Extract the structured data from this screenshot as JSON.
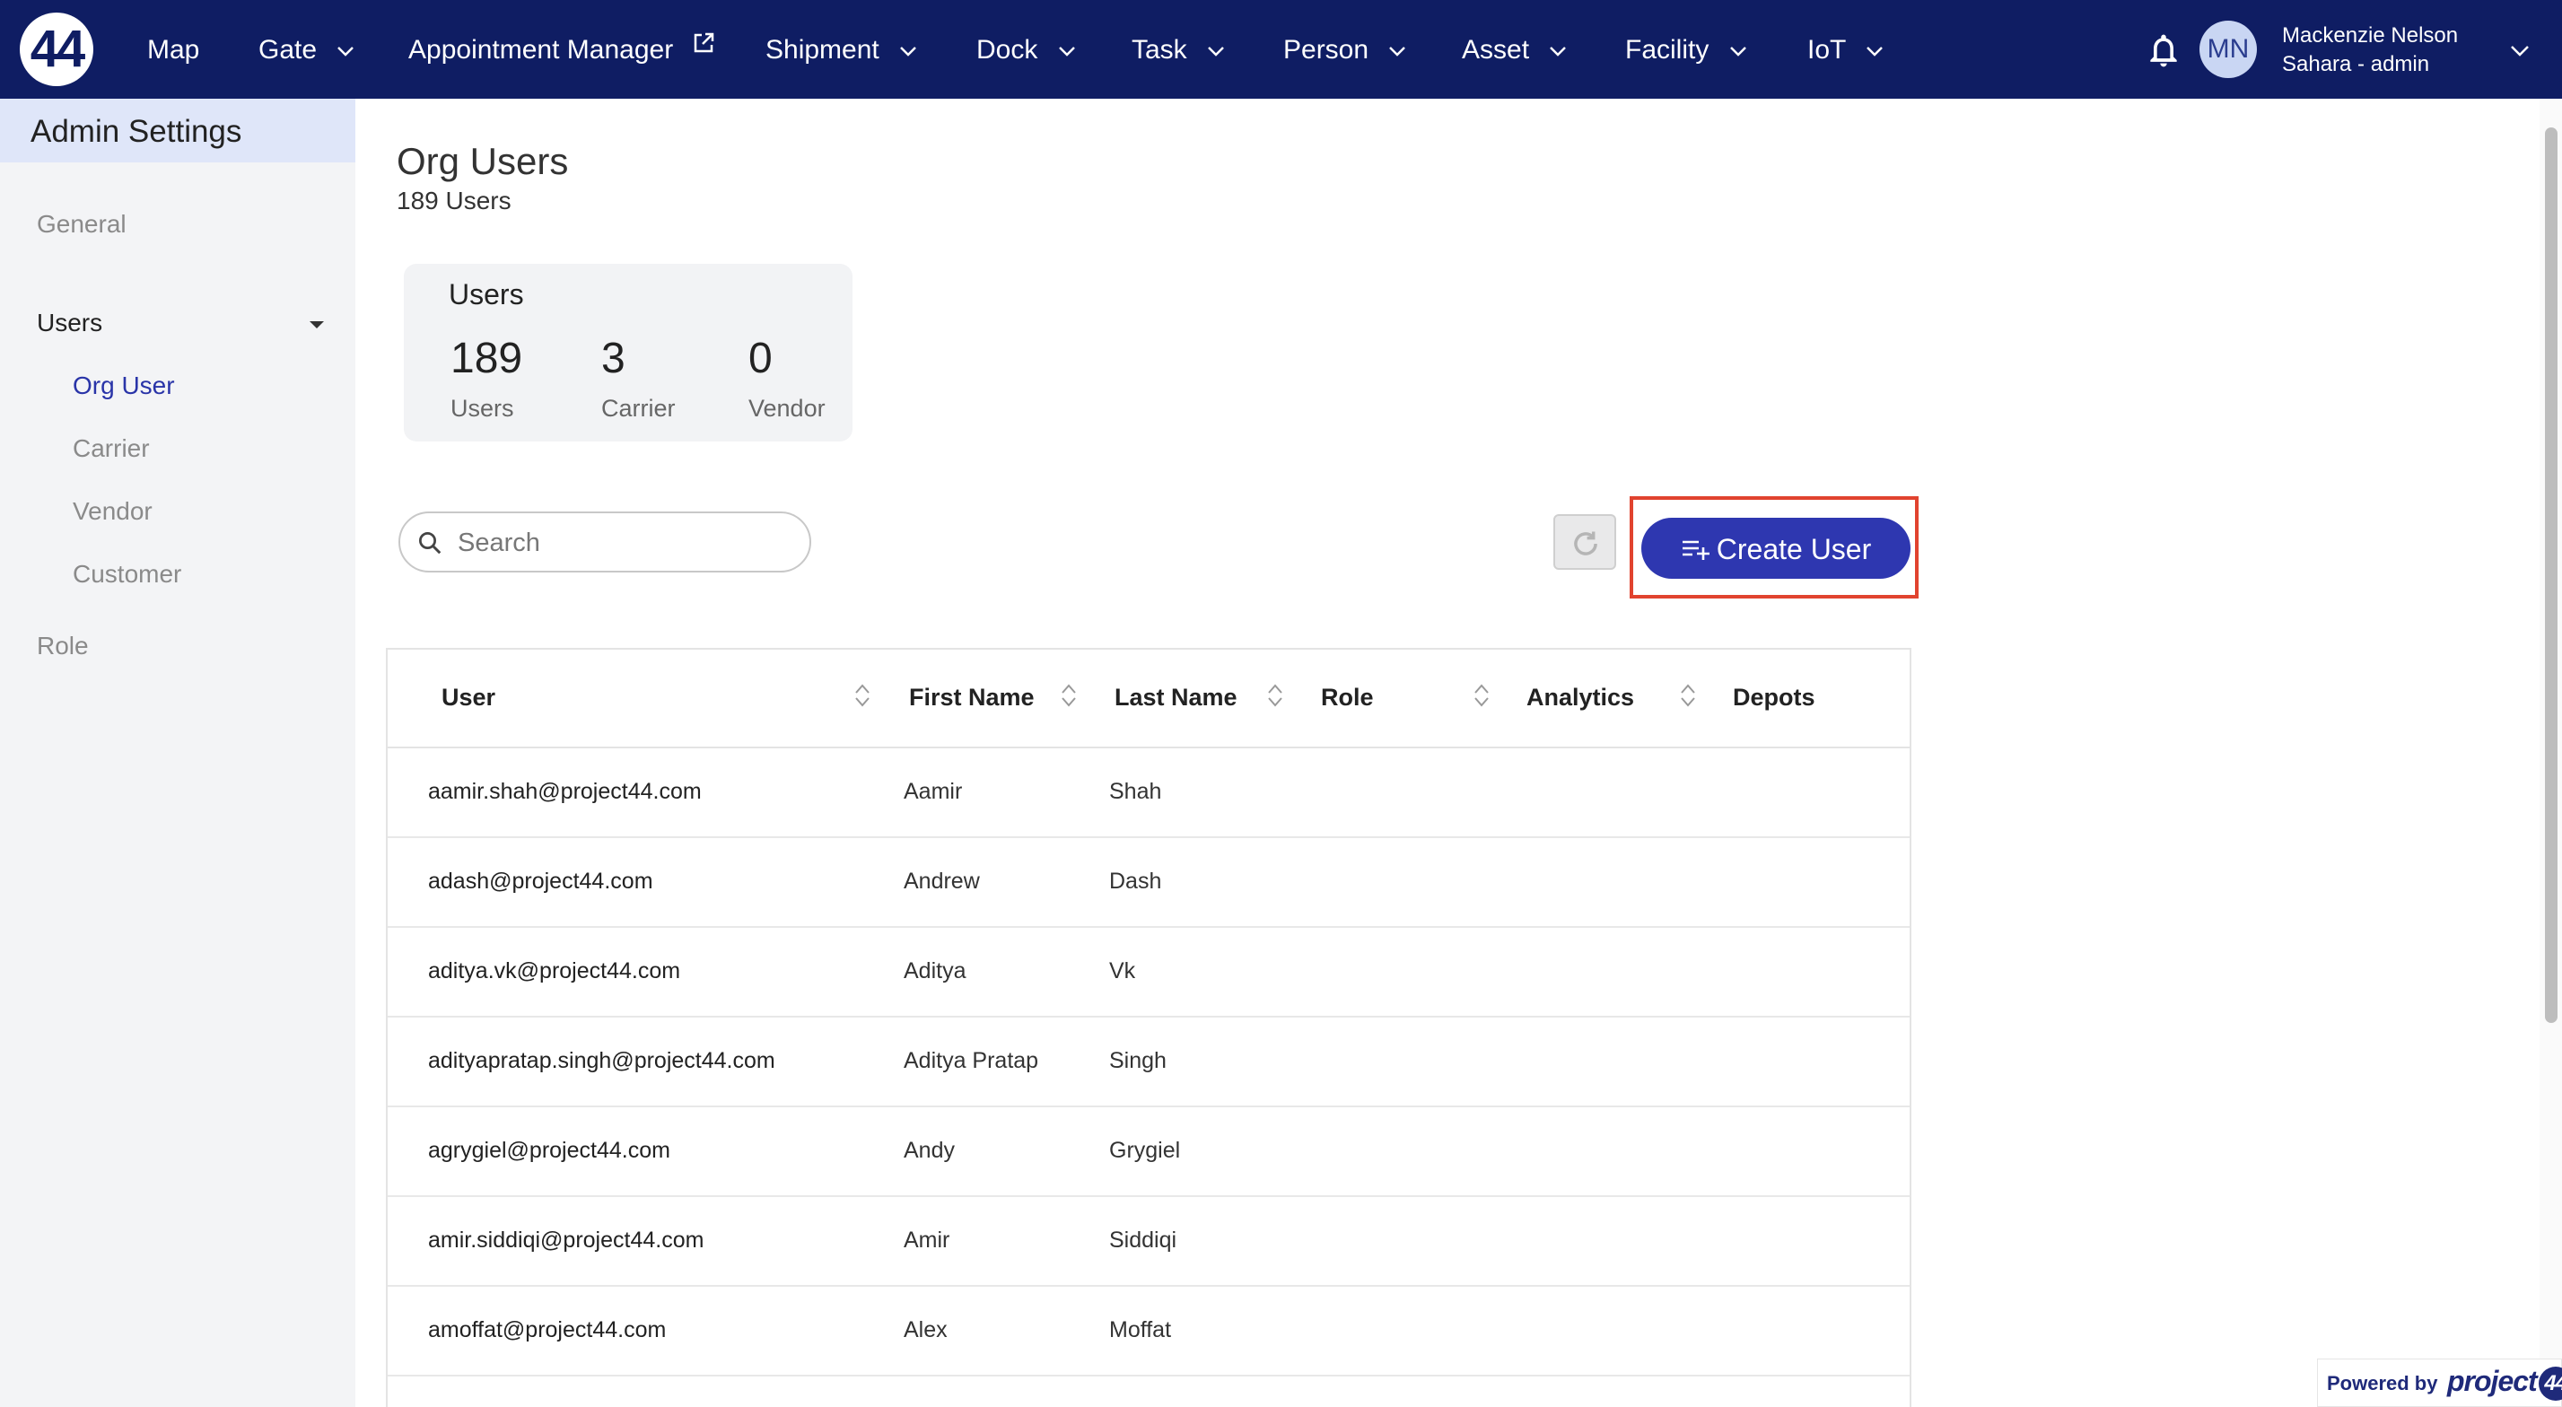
{
  "brand": {
    "logo_text": "44"
  },
  "nav": {
    "items": [
      {
        "label": "Map",
        "dropdown": false
      },
      {
        "label": "Gate",
        "dropdown": true
      },
      {
        "label": "Appointment Manager",
        "dropdown": false,
        "external": true
      },
      {
        "label": "Shipment",
        "dropdown": true
      },
      {
        "label": "Dock",
        "dropdown": true
      },
      {
        "label": "Task",
        "dropdown": true
      },
      {
        "label": "Person",
        "dropdown": true
      },
      {
        "label": "Asset",
        "dropdown": true
      },
      {
        "label": "Facility",
        "dropdown": true
      },
      {
        "label": "IoT",
        "dropdown": true
      }
    ],
    "user": {
      "initials": "MN",
      "name": "Mackenzie Nelson",
      "role": "Sahara - admin"
    }
  },
  "sidebar": {
    "title": "Admin Settings",
    "items": {
      "general": "General",
      "users": "Users",
      "org_user": "Org User",
      "carrier": "Carrier",
      "vendor": "Vendor",
      "customer": "Customer",
      "role": "Role"
    }
  },
  "main": {
    "title": "Org Users",
    "subtitle": "189 Users",
    "stats": {
      "heading": "Users",
      "users": {
        "value": "189",
        "label": "Users"
      },
      "carrier": {
        "value": "3",
        "label": "Carrier"
      },
      "vendor": {
        "value": "0",
        "label": "Vendor"
      }
    },
    "search": {
      "placeholder": "Search",
      "value": ""
    },
    "create_button": "Create User"
  },
  "table": {
    "columns": [
      "User",
      "First Name",
      "Last Name",
      "Role",
      "Analytics",
      "Depots"
    ],
    "rows": [
      {
        "email": "aamir.shah@project44.com",
        "first": "Aamir",
        "last": "Shah"
      },
      {
        "email": "adash@project44.com",
        "first": "Andrew",
        "last": "Dash"
      },
      {
        "email": "aditya.vk@project44.com",
        "first": "Aditya",
        "last": "Vk"
      },
      {
        "email": "adityapratap.singh@project44.com",
        "first": "Aditya Pratap",
        "last": "Singh"
      },
      {
        "email": "agrygiel@project44.com",
        "first": "Andy",
        "last": "Grygiel"
      },
      {
        "email": "amir.siddiqi@project44.com",
        "first": "Amir",
        "last": "Siddiqi"
      },
      {
        "email": "amoffat@project44.com",
        "first": "Alex",
        "last": "Moffat"
      }
    ]
  },
  "footer": {
    "powered_by": "Powered by",
    "brand": "project",
    "brand_mark": "44"
  },
  "colors": {
    "nav_bg": "#0f1d63",
    "accent": "#2e37b0",
    "highlight_outline": "#e1432f",
    "sidebar_active": "#2934a8"
  }
}
